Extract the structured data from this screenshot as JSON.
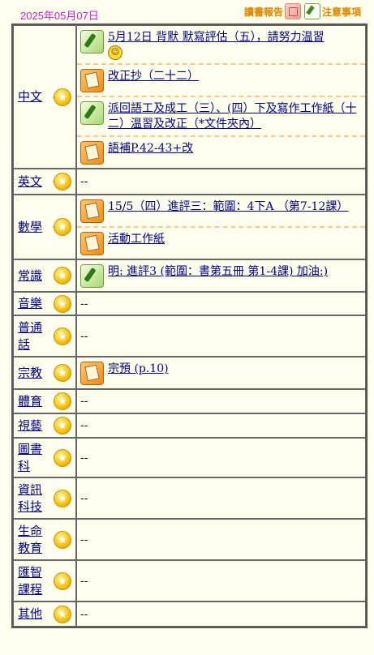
{
  "date": "2025年05月07日",
  "top_links": [
    {
      "label": "讀書報告",
      "icon": "book-report-icon"
    },
    {
      "label": "注意事項",
      "icon": "notes-icon"
    }
  ],
  "no_homework": "--",
  "subjects": [
    {
      "name": "中文",
      "items": [
        {
          "icon": "green",
          "text": "5月12日 背默 默寫評估（五），請努力温習",
          "smiley": true
        },
        {
          "icon": "orange",
          "text": "改正抄（二十二）"
        },
        {
          "icon": "green",
          "text": "派回語工及成工（三）、(四）下及寫作工作紙（十二）温習及改正（*文件夾內）"
        },
        {
          "icon": "orange",
          "text": "語補P.42-43+改"
        }
      ]
    },
    {
      "name": "英文",
      "items": []
    },
    {
      "name": "數學",
      "items": [
        {
          "icon": "orange",
          "text": "15/5（四）進評三：範圍：4下A （第7-12課）"
        },
        {
          "icon": "orange",
          "text": "活動工作紙"
        }
      ]
    },
    {
      "name": "常識",
      "items": [
        {
          "icon": "green",
          "text": "明: 進評3 (範圍：書第五冊 第1-4課) 加油:)"
        }
      ]
    },
    {
      "name": "音樂",
      "items": []
    },
    {
      "name": "普通話",
      "items": []
    },
    {
      "name": "宗教",
      "items": [
        {
          "icon": "orange",
          "text": "宗預 (p.10)"
        }
      ]
    },
    {
      "name": "體育",
      "items": []
    },
    {
      "name": "視藝",
      "items": []
    },
    {
      "name": "圖書科",
      "items": []
    },
    {
      "name": "資訊科技",
      "items": []
    },
    {
      "name": "生命教育",
      "items": []
    },
    {
      "name": "匯智課程",
      "items": []
    },
    {
      "name": "其他",
      "items": []
    }
  ]
}
